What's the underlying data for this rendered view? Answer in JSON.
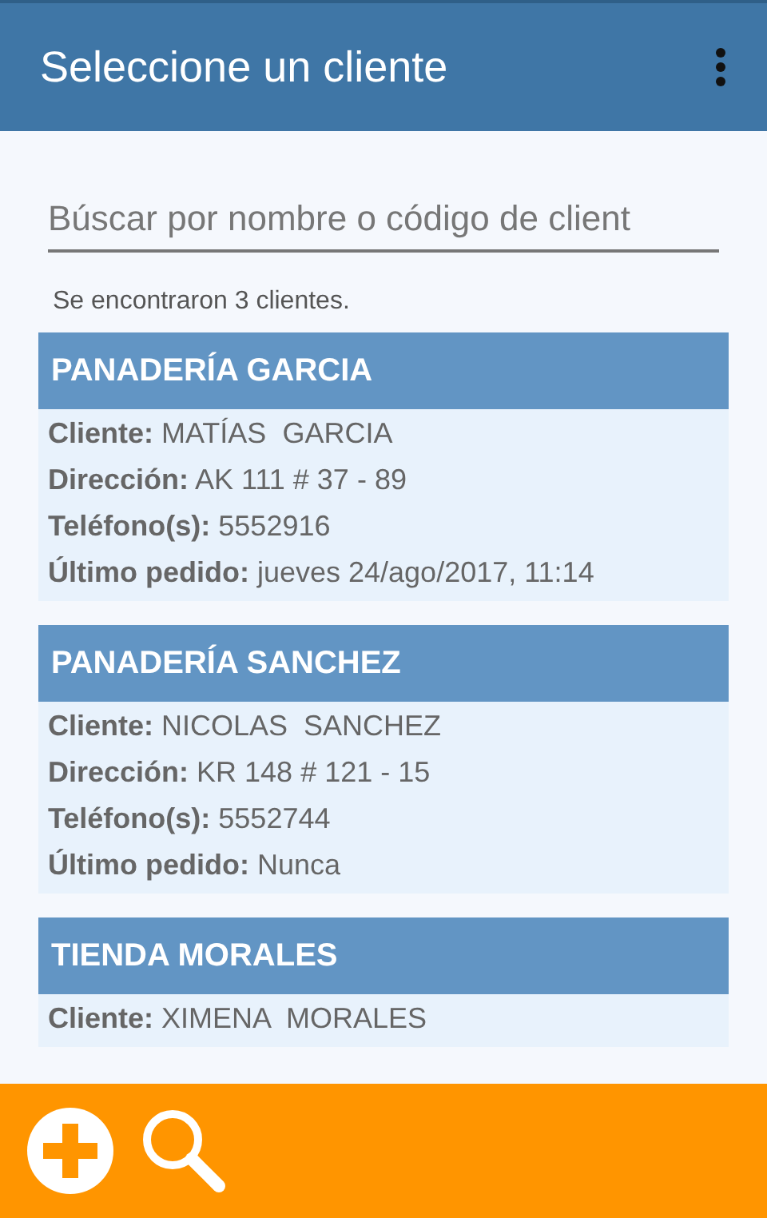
{
  "app_bar": {
    "title": "Seleccione un cliente"
  },
  "search": {
    "placeholder": "Búscar por nombre o código de client"
  },
  "result_count": "Se encontraron 3 clientes.",
  "clients": [
    {
      "name": "PANADERÍA GARCIA",
      "details": [
        {
          "label": "Cliente:",
          "value": "MATÍAS  GARCIA"
        },
        {
          "label": "Dirección:",
          "value": "AK 111 # 37 - 89"
        },
        {
          "label": "Teléfono(s):",
          "value": "5552916"
        },
        {
          "label": "Último pedido:",
          "value": "jueves 24/ago/2017, 11:14"
        }
      ]
    },
    {
      "name": "PANADERÍA SANCHEZ",
      "details": [
        {
          "label": "Cliente:",
          "value": "NICOLAS  SANCHEZ"
        },
        {
          "label": "Dirección:",
          "value": "KR 148 # 121 - 15"
        },
        {
          "label": "Teléfono(s):",
          "value": "5552744"
        },
        {
          "label": "Último pedido:",
          "value": "Nunca"
        }
      ]
    },
    {
      "name": "TIENDA MORALES",
      "details": [
        {
          "label": "Cliente:",
          "value": "XIMENA  MORALES"
        }
      ]
    }
  ],
  "bottom_bar": {
    "actions": [
      {
        "kind": "add"
      },
      {
        "kind": "search"
      }
    ]
  }
}
